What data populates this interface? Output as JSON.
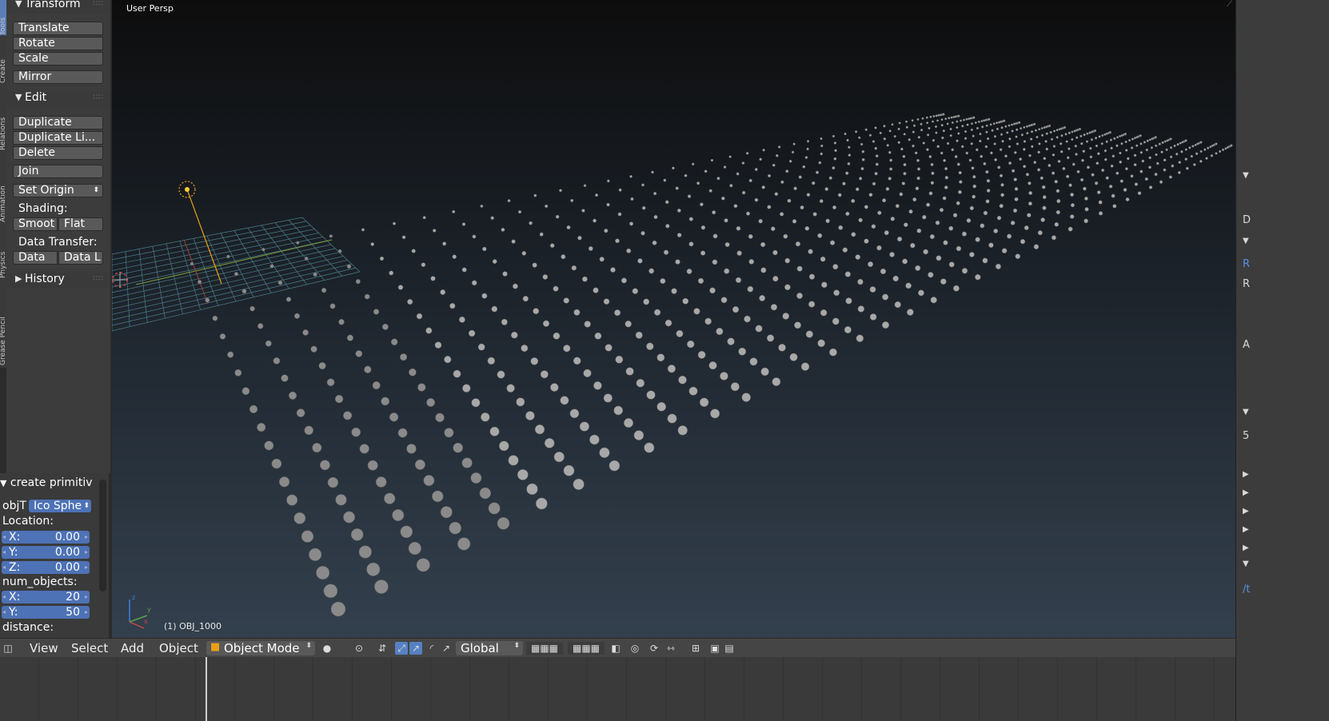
{
  "viewport": {
    "title": "User Persp",
    "active_object": "(1) OBJ_1000",
    "grid_rows": 20,
    "grid_cols": 50,
    "background_top": "#0d0d0d",
    "background_bottom": "#33404d"
  },
  "tabs": [
    "Tools",
    "Create",
    "Relations",
    "Animation",
    "Physics",
    "Grease Pencil"
  ],
  "tool_shelf": {
    "transform": {
      "title": "Transform",
      "buttons": [
        "Translate",
        "Rotate",
        "Scale",
        "Mirror"
      ]
    },
    "edit": {
      "title": "Edit",
      "buttons": [
        "Duplicate",
        "Duplicate Li...",
        "Delete",
        "Join"
      ],
      "set_origin": "Set Origin",
      "shading_label": "Shading:",
      "shading_smooth": "Smoot",
      "shading_flat": "Flat",
      "data_transfer_label": "Data Transfer:",
      "data": "Data",
      "data_l": "Data L"
    },
    "history": {
      "title": "History"
    }
  },
  "operator_panel": {
    "title": "create primitiv",
    "obj_type_label": "objT",
    "obj_type_value": "Ico Sphe",
    "location_label": "Location:",
    "loc_x_label": "X:",
    "loc_x": "0.00",
    "loc_y_label": "Y:",
    "loc_y": "0.00",
    "loc_z_label": "Z:",
    "loc_z": "0.00",
    "num_objects_label": "num_objects:",
    "num_x_label": "X:",
    "num_x": "20",
    "num_y_label": "Y:",
    "num_y": "50",
    "distance_label": "distance:"
  },
  "header": {
    "view": "View",
    "select": "Select",
    "add": "Add",
    "object": "Object",
    "mode": "Object Mode",
    "orientation": "Global"
  },
  "right_panel": {
    "letters": [
      "D",
      "R",
      "R",
      "A",
      "5",
      "/t"
    ]
  }
}
